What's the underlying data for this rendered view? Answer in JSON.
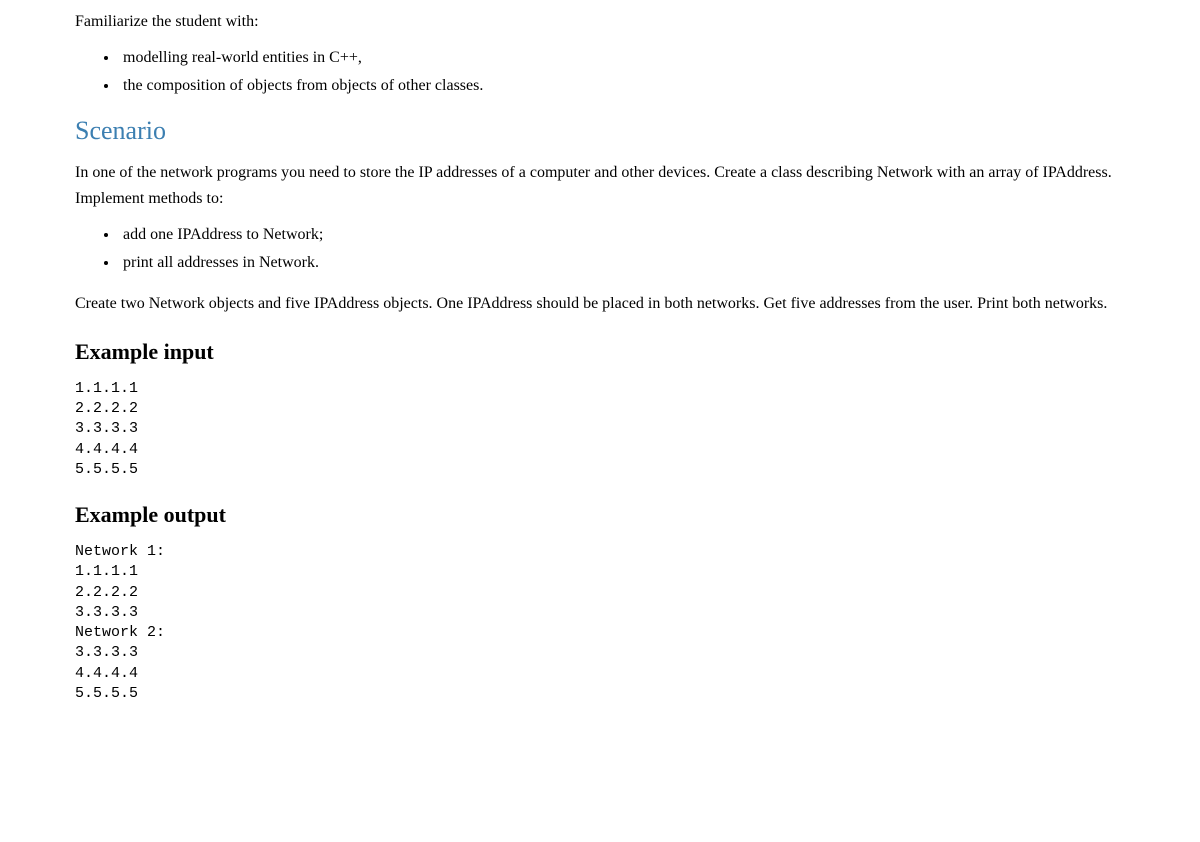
{
  "intro": "Familiarize the student with:",
  "objectives": [
    "modelling real-world entities in C++,",
    "the composition of objects from objects of other classes."
  ],
  "scenario_heading": "Scenario",
  "scenario_p1": "In one of the network programs you need to store the IP addresses of a computer and other devices. Create a class describing Network with an array of IPAddress. Implement methods to:",
  "scenario_bullets": [
    "add one IPAddress to Network;",
    "print all addresses in Network."
  ],
  "scenario_p2": "Create two Network objects and five IPAddress objects. One IPAddress should be placed in both networks. Get five addresses from the user. Print both networks.",
  "example_input_heading": "Example input",
  "example_input": "1.1.1.1\n2.2.2.2\n3.3.3.3\n4.4.4.4\n5.5.5.5",
  "example_output_heading": "Example output",
  "example_output": "Network 1:\n1.1.1.1\n2.2.2.2\n3.3.3.3\nNetwork 2:\n3.3.3.3\n4.4.4.4\n5.5.5.5"
}
